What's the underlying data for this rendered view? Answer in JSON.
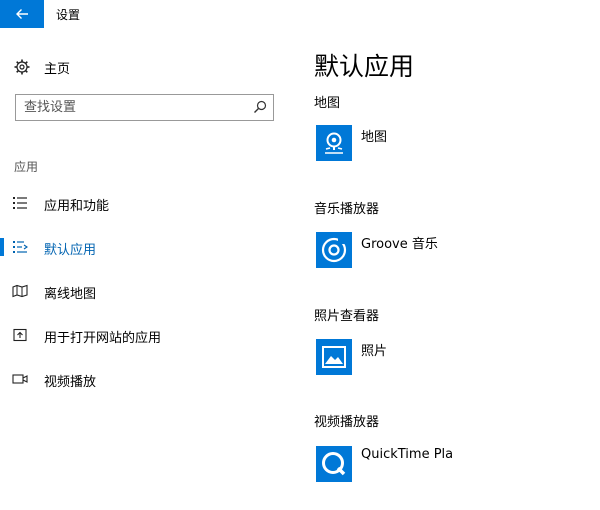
{
  "window": {
    "title": "设置"
  },
  "sidebar": {
    "home_label": "主页",
    "search_placeholder": "查找设置",
    "section_label": "应用",
    "items": [
      {
        "label": "应用和功能",
        "icon": "list-icon"
      },
      {
        "label": "默认应用",
        "icon": "default-apps-icon",
        "selected": true
      },
      {
        "label": "离线地图",
        "icon": "offline-map-icon"
      },
      {
        "label": "用于打开网站的应用",
        "icon": "open-web-icon"
      },
      {
        "label": "视频播放",
        "icon": "video-icon"
      }
    ]
  },
  "main": {
    "title": "默认应用",
    "categories": [
      {
        "label": "地图",
        "app": "地图",
        "icon": "maps-app-icon"
      },
      {
        "label": "音乐播放器",
        "app": "Groove 音乐",
        "icon": "groove-app-icon"
      },
      {
        "label": "照片查看器",
        "app": "照片",
        "icon": "photos-app-icon"
      },
      {
        "label": "视频播放器",
        "app": "QuickTime Pla",
        "icon": "quicktime-app-icon"
      }
    ]
  },
  "colors": {
    "accent": "#0078d7",
    "selected_text": "#0063b1"
  }
}
